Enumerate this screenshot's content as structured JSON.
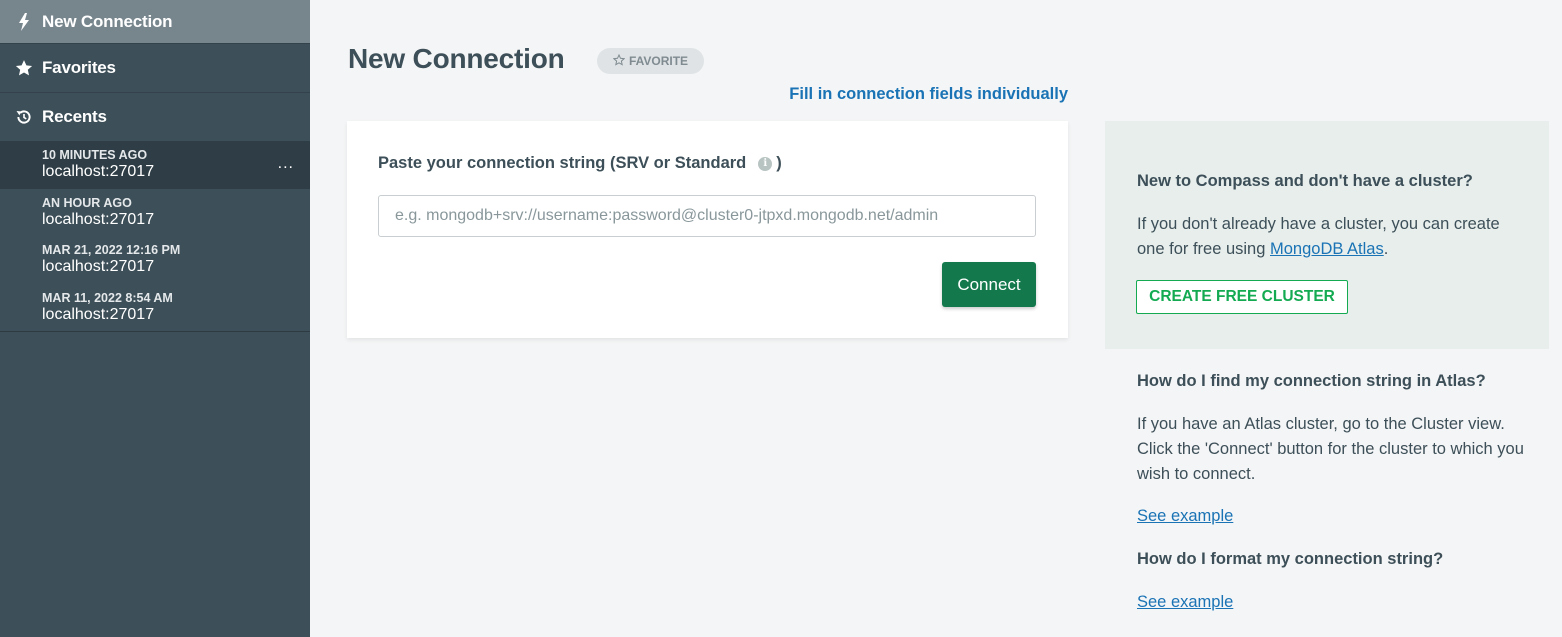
{
  "sidebar": {
    "new_connection": "New Connection",
    "favorites": "Favorites",
    "recents": "Recents",
    "recent_items": [
      {
        "time": "10 MINUTES AGO",
        "host": "localhost:27017"
      },
      {
        "time": "AN HOUR AGO",
        "host": "localhost:27017"
      },
      {
        "time": "MAR 21, 2022 12:16 PM",
        "host": "localhost:27017"
      },
      {
        "time": "MAR 11, 2022 8:54 AM",
        "host": "localhost:27017"
      }
    ],
    "more_label": "..."
  },
  "main": {
    "title": "New Connection",
    "favorite_label": "FAVORITE",
    "fill_fields_link": "Fill in connection fields individually",
    "connection_label": "Paste your connection string (SRV or Standard",
    "connection_label_close": ")",
    "info_glyph": "i",
    "input_placeholder": "e.g. mongodb+srv://username:password@cluster0-jtpxd.mongodb.net/admin",
    "input_value": "",
    "connect_label": "Connect"
  },
  "help": {
    "new_heading": "New to Compass and don't have a cluster?",
    "new_text": "If you don't already have a cluster, you can create one for free using ",
    "atlas_link": "MongoDB Atlas",
    "new_text_end": ".",
    "create_cluster": "CREATE FREE CLUSTER",
    "find_heading": "How do I find my connection string in Atlas?",
    "find_text": "If you have an Atlas cluster, go to the Cluster view. Click the 'Connect' button for the cluster to which you wish to connect.",
    "see_example_1": "See example",
    "format_heading": "How do I format my connection string?",
    "see_example_2": "See example"
  },
  "colors": {
    "sidebar_bg": "#3d4f58",
    "sidebar_active": "#77858d",
    "connect_green": "#13794c",
    "cluster_green": "#13aa52",
    "link_blue": "#1a73b5"
  },
  "icons": {
    "new_connection": "lightning-bolt-icon",
    "favorites": "star-icon",
    "recents": "history-icon",
    "favorite_pill": "star-outline-icon",
    "info": "info-icon"
  }
}
